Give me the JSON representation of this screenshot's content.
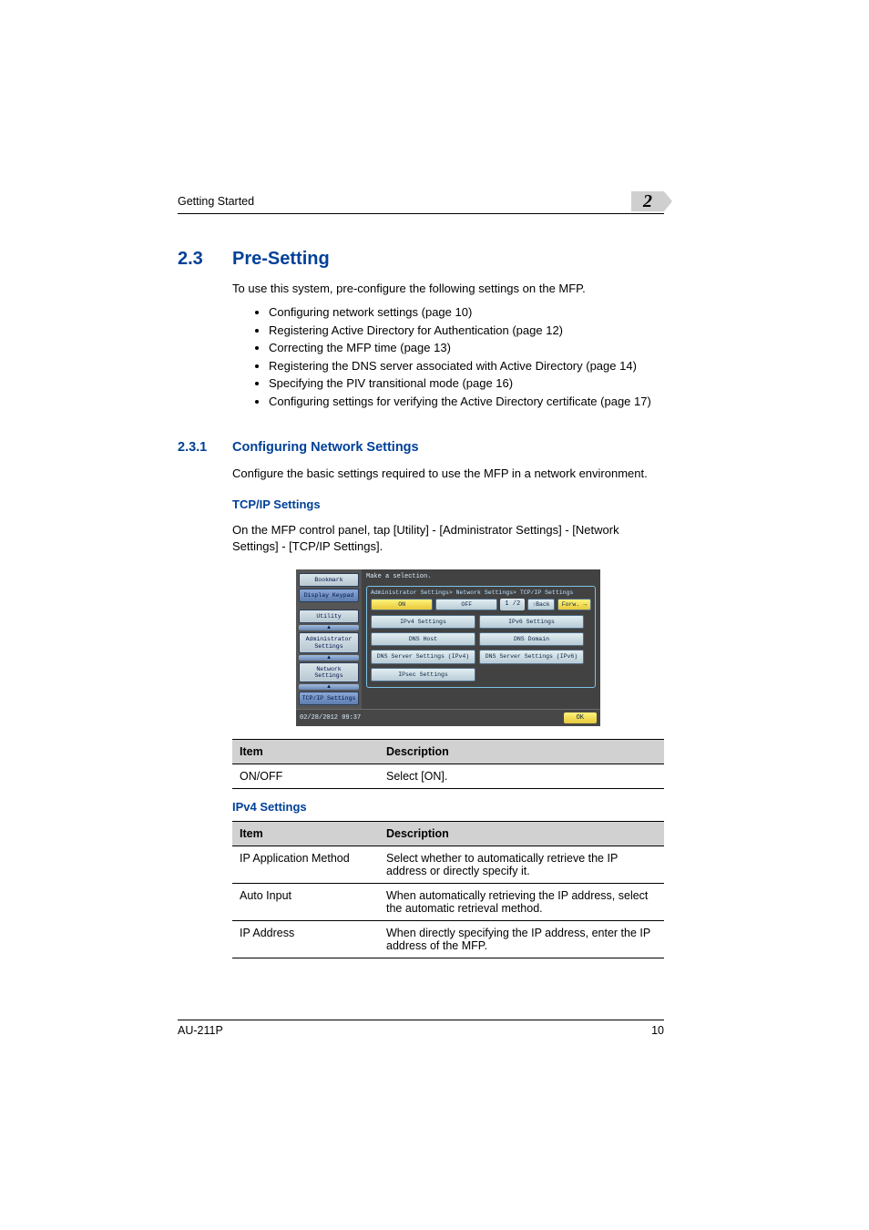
{
  "header": {
    "left": "Getting Started",
    "chapter": "2"
  },
  "section": {
    "num": "2.3",
    "title": "Pre-Setting",
    "intro": "To use this system, pre-configure the following settings on the MFP.",
    "bullets": [
      "Configuring network settings (page 10)",
      "Registering Active Directory for Authentication (page 12)",
      "Correcting the MFP time (page 13)",
      "Registering the DNS server associated with Active Directory (page 14)",
      "Specifying the PIV transitional mode (page 16)",
      "Configuring settings for verifying the Active Directory certificate (page 17)"
    ]
  },
  "subsection": {
    "num": "2.3.1",
    "title": "Configuring Network Settings",
    "intro": "Configure the basic settings required to use the MFP in a network environment."
  },
  "tcpip": {
    "heading": "TCP/IP Settings",
    "text": "On the MFP control panel, tap [Utility] - [Administrator Settings] - [Network Settings] - [TCP/IP Settings]."
  },
  "screenshot": {
    "instruction": "Make a selection.",
    "breadcrumb": "Administrator Settings> Network Settings> TCP/IP Settings",
    "sidebar": [
      "Bookmark",
      "Display Keypad",
      "Utility",
      "Administrator Settings",
      "Network Settings",
      "TCP/IP Settings"
    ],
    "arrow": "▲",
    "on": "ON",
    "off": "OFF",
    "page": "1 /2",
    "back": "↑Back",
    "fwd": "Forw. →",
    "buttons": [
      "IPv4 Settings",
      "IPv6 Settings",
      "DNS Host",
      "DNS Domain",
      "DNS Server Settings (IPv4)",
      "DNS Server Settings (IPv6)",
      "IPsec Settings"
    ],
    "timestamp": "02/28/2012   09:37",
    "ok": "OK"
  },
  "table1": {
    "headers": [
      "Item",
      "Description"
    ],
    "rows": [
      {
        "item": "ON/OFF",
        "desc": "Select [ON]."
      }
    ]
  },
  "ipv4_heading": "IPv4 Settings",
  "table2": {
    "headers": [
      "Item",
      "Description"
    ],
    "rows": [
      {
        "item": "IP Application Method",
        "desc": "Select whether to automatically retrieve the IP address or directly specify it."
      },
      {
        "item": "Auto Input",
        "desc": "When automatically retrieving the IP address, select the automatic retrieval method."
      },
      {
        "item": "IP Address",
        "desc": "When directly specifying the IP address, enter the IP address of the MFP."
      }
    ]
  },
  "footer": {
    "left": "AU-211P",
    "right": "10"
  }
}
